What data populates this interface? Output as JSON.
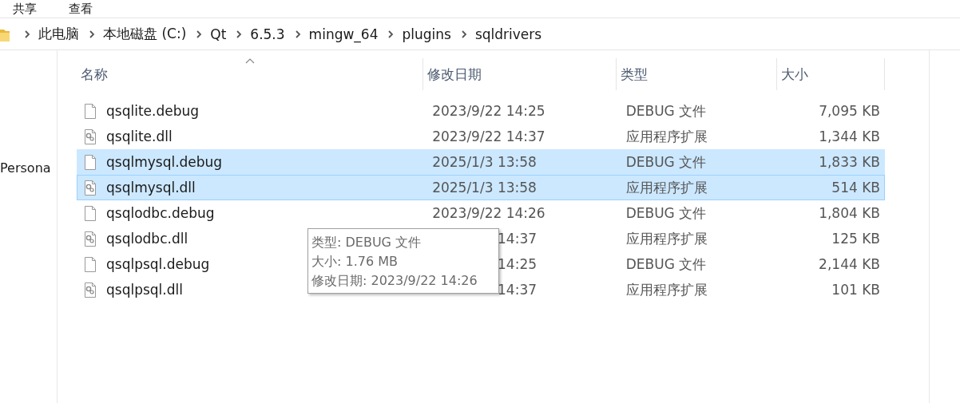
{
  "menu": [
    {
      "label": "共享"
    },
    {
      "label": "查看"
    }
  ],
  "breadcrumb": [
    "此电脑",
    "本地磁盘 (C:)",
    "Qt",
    "6.5.3",
    "mingw_64",
    "plugins",
    "sqldrivers"
  ],
  "nav_pane": {
    "items": [
      {
        "label": "Persona"
      }
    ]
  },
  "table": {
    "columns": [
      {
        "label": "名称",
        "sorted": true
      },
      {
        "label": "修改日期",
        "sorted": false
      },
      {
        "label": "类型",
        "sorted": false
      },
      {
        "label": "大小",
        "sorted": false
      }
    ],
    "rows": [
      {
        "kind": "debug",
        "name": "qsqlite.debug",
        "date": "2023/9/22 14:25",
        "type": "DEBUG 文件",
        "size": "7,095 KB",
        "selected": false,
        "focused": false
      },
      {
        "kind": "dll",
        "name": "qsqlite.dll",
        "date": "2023/9/22 14:37",
        "type": "应用程序扩展",
        "size": "1,344 KB",
        "selected": false,
        "focused": false
      },
      {
        "kind": "debug",
        "name": "qsqlmysql.debug",
        "date": "2025/1/3 13:58",
        "type": "DEBUG 文件",
        "size": "1,833 KB",
        "selected": true,
        "focused": false
      },
      {
        "kind": "dll",
        "name": "qsqlmysql.dll",
        "date": "2025/1/3 13:58",
        "type": "应用程序扩展",
        "size": "514 KB",
        "selected": true,
        "focused": true
      },
      {
        "kind": "debug",
        "name": "qsqlodbc.debug",
        "date": "2023/9/22 14:26",
        "type": "DEBUG 文件",
        "size": "1,804 KB",
        "selected": false,
        "focused": false
      },
      {
        "kind": "dll",
        "name": "qsqlodbc.dll",
        "date": "14:37",
        "date_covered": true,
        "type": "应用程序扩展",
        "size": "125 KB",
        "selected": false,
        "focused": false
      },
      {
        "kind": "debug",
        "name": "qsqlpsql.debug",
        "date": "14:25",
        "date_covered": true,
        "type": "DEBUG 文件",
        "size": "2,144 KB",
        "selected": false,
        "focused": false
      },
      {
        "kind": "dll",
        "name": "qsqlpsql.dll",
        "date": "14:37",
        "date_covered": true,
        "type": "应用程序扩展",
        "size": "101 KB",
        "selected": false,
        "focused": false
      }
    ]
  },
  "tooltip": {
    "lines": [
      "类型: DEBUG 文件",
      "大小: 1.76 MB",
      "修改日期: 2023/9/22 14:26"
    ]
  }
}
